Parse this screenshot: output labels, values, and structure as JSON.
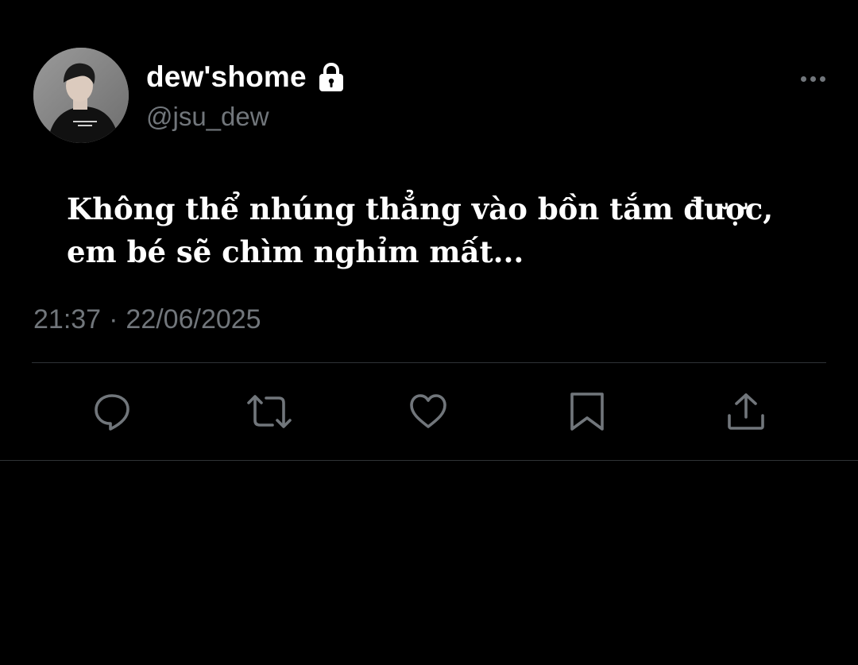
{
  "user": {
    "display_name": "dew'shome",
    "handle": "@jsu_dew",
    "protected_icon": "lock-icon",
    "avatar_icon": "avatar"
  },
  "tweet": {
    "lines": [
      "Không thể nhúng thẳng vào bồn tắm được,",
      "em bé sẽ chìm nghỉm mất..."
    ],
    "time": "21:37",
    "separator": "·",
    "date": "22/06/2025"
  },
  "actions": [
    {
      "name": "reply",
      "icon": "speech-bubble-icon"
    },
    {
      "name": "retweet",
      "icon": "retweet-icon"
    },
    {
      "name": "like",
      "icon": "heart-icon"
    },
    {
      "name": "bookmark",
      "icon": "bookmark-icon"
    },
    {
      "name": "share",
      "icon": "share-icon"
    }
  ],
  "more_menu_icon": "more-dots-icon",
  "colors": {
    "background": "#000000",
    "primary_text": "#ffffff",
    "secondary_text": "#71767b",
    "divider": "#2f3336"
  }
}
